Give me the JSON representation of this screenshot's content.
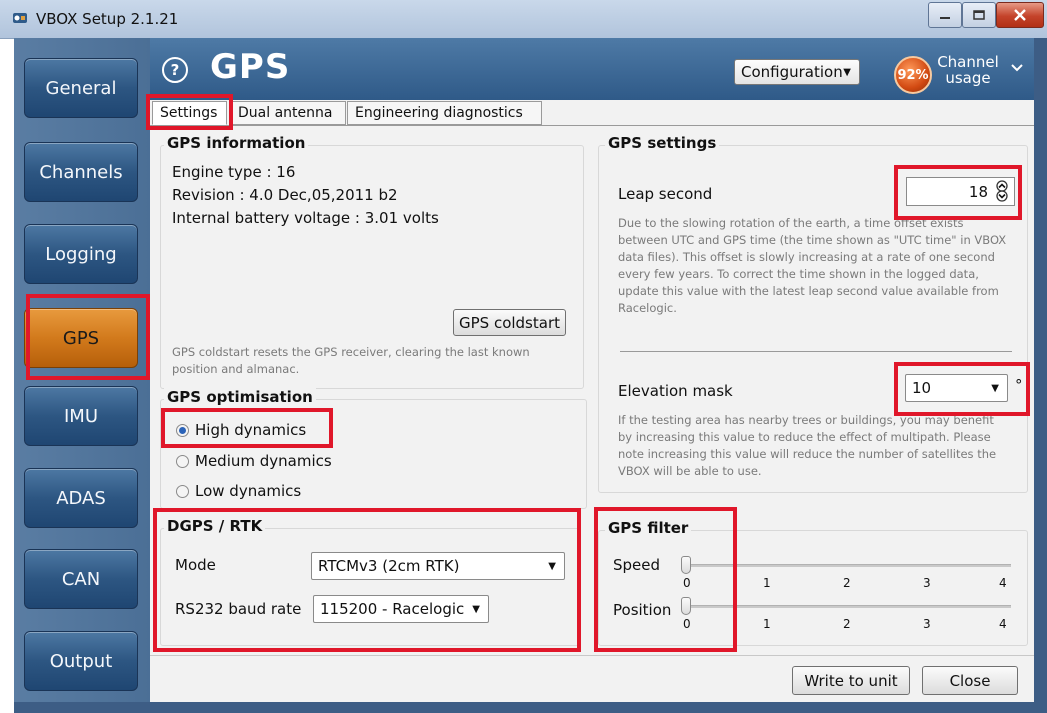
{
  "window": {
    "title": "VBOX Setup 2.1.21"
  },
  "nav": {
    "items": [
      {
        "label": "General"
      },
      {
        "label": "Channels"
      },
      {
        "label": "Logging"
      },
      {
        "label": "GPS",
        "active": true
      },
      {
        "label": "IMU"
      },
      {
        "label": "ADAS"
      },
      {
        "label": "CAN"
      },
      {
        "label": "Output"
      }
    ]
  },
  "header": {
    "help_icon": "?",
    "title": "GPS",
    "configuration_label": "Configuration",
    "channel_usage_percent": "92%",
    "channel_usage_label": "Channel usage"
  },
  "tabs": [
    {
      "label": "Settings",
      "active": true
    },
    {
      "label": "Dual antenna"
    },
    {
      "label": "Engineering diagnostics"
    }
  ],
  "gps_information": {
    "title": "GPS information",
    "engine_type": "Engine type : 16",
    "revision": "Revision : 4.0 Dec,05,2011 b2",
    "battery": "Internal battery voltage : 3.01 volts",
    "coldstart_button": "GPS coldstart",
    "coldstart_note": "GPS coldstart resets the GPS receiver, clearing the last known position and almanac."
  },
  "gps_optimisation": {
    "title": "GPS optimisation",
    "options": [
      {
        "label": "High dynamics",
        "selected": true
      },
      {
        "label": "Medium dynamics",
        "selected": false
      },
      {
        "label": "Low dynamics",
        "selected": false
      }
    ]
  },
  "dgps_rtk": {
    "title": "DGPS / RTK",
    "mode_label": "Mode",
    "mode_value": "RTCMv3 (2cm RTK)",
    "baud_label": "RS232 baud rate",
    "baud_value": "115200 - Racelogic"
  },
  "gps_settings": {
    "title": "GPS settings",
    "leap_second_label": "Leap second",
    "leap_second_value": "18",
    "leap_second_help": "Due to the slowing rotation of the earth, a time offset exists between UTC and GPS time (the time shown as \"UTC time\" in VBOX data files).  This offset is slowly increasing at a rate of one second every few years.  To correct the time shown in the logged data, update this value with the latest leap second value available from Racelogic.",
    "elevation_mask_label": "Elevation mask",
    "elevation_mask_value": "10",
    "elevation_unit": "°",
    "elevation_help": "If the testing area has nearby trees or buildings, you may benefit by increasing this value to reduce the effect of multipath.  Please note increasing this value will reduce the number of satellites the VBOX will be able to use."
  },
  "gps_filter": {
    "title": "GPS filter",
    "speed_label": "Speed",
    "speed_value": 0,
    "position_label": "Position",
    "position_value": 0,
    "ticks": [
      "0",
      "1",
      "2",
      "3",
      "4"
    ]
  },
  "footer": {
    "write_button": "Write to unit",
    "close_button": "Close"
  }
}
